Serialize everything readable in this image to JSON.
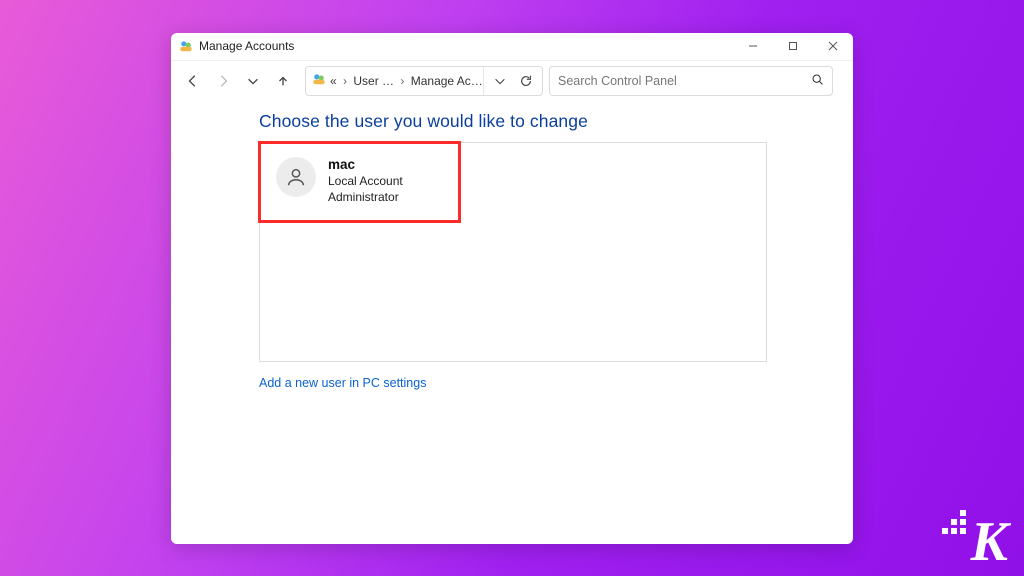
{
  "window": {
    "title": "Manage Accounts"
  },
  "breadcrumb": {
    "root_label": "«",
    "segment1": "User …",
    "segment2": "Manage Accou…"
  },
  "search": {
    "placeholder": "Search Control Panel"
  },
  "page": {
    "heading": "Choose the user you would like to change",
    "add_user_link": "Add a new user in PC settings"
  },
  "accounts": [
    {
      "name": "mac",
      "type": "Local Account",
      "role": "Administrator"
    }
  ],
  "watermark": {
    "letter": "K"
  }
}
